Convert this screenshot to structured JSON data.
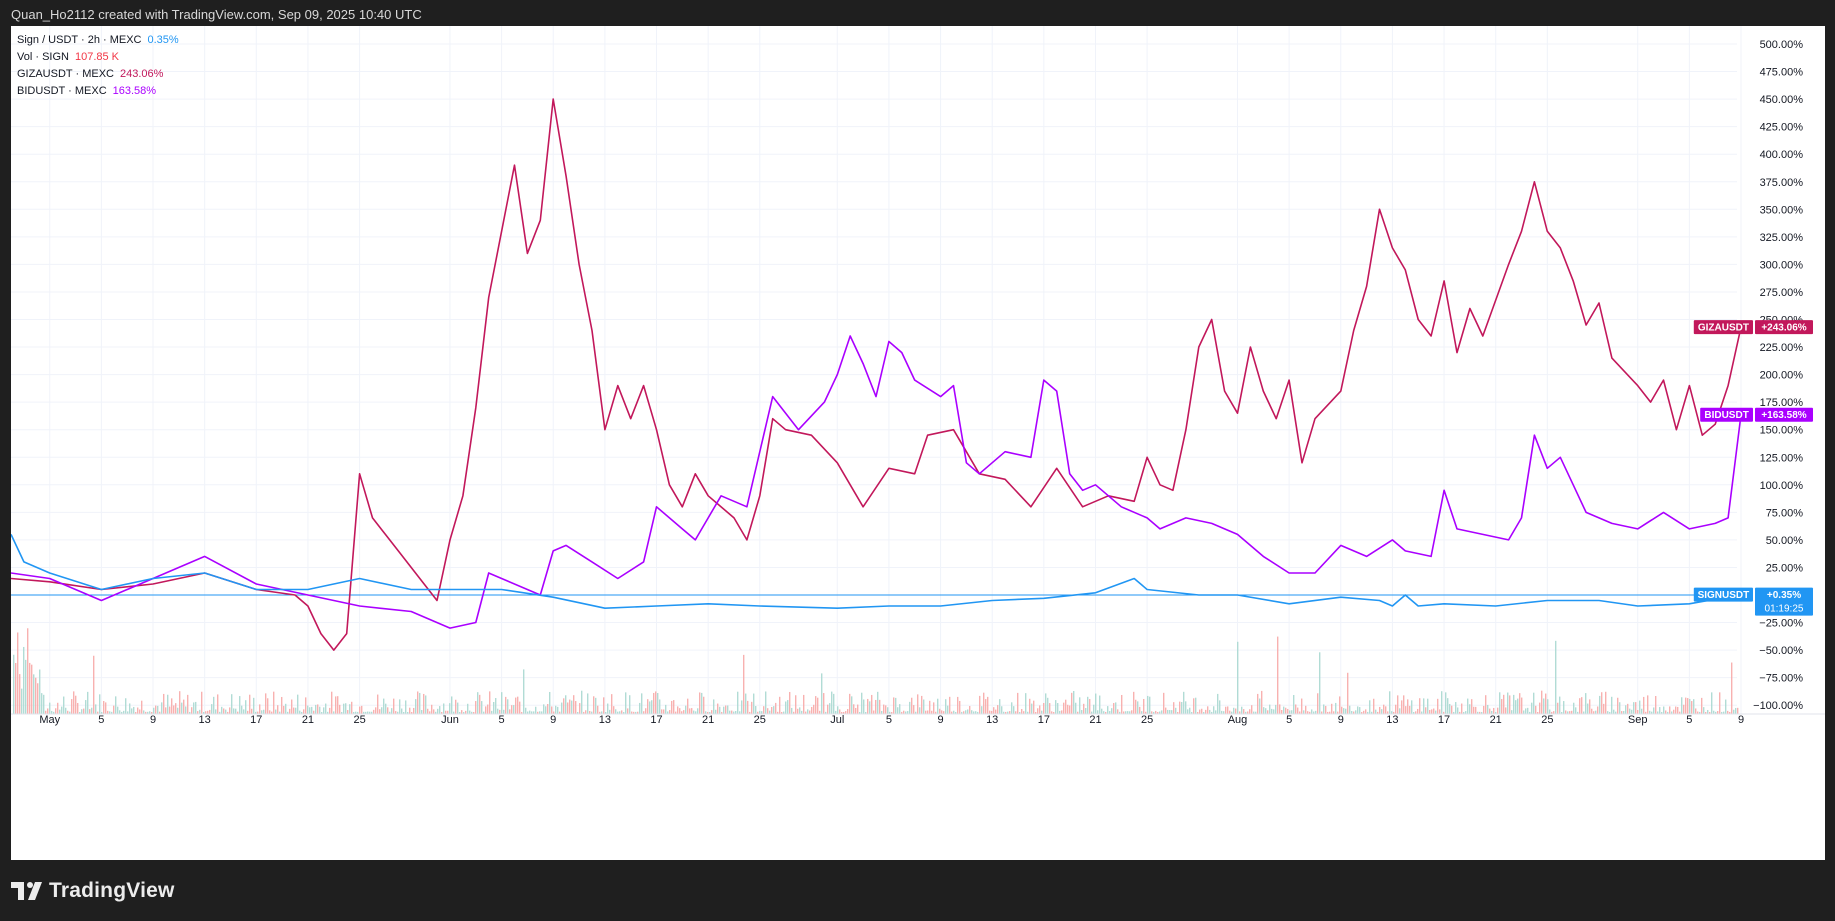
{
  "header": {
    "text": "Quan_Ho2112 created with TradingView.com, Sep 09, 2025 10:40 UTC"
  },
  "legend": [
    {
      "label": "Sign / USDT · 2h · MEXC",
      "value": "0.35%",
      "color": "#2196f3"
    },
    {
      "label": "Vol · SIGN",
      "value": "107.85 K",
      "color": "#f23645"
    },
    {
      "label": "GIZAUSDT · MEXC",
      "value": "243.06%",
      "color": "#c2185b"
    },
    {
      "label": "BIDUSDT · MEXC",
      "value": "163.58%",
      "color": "#aa00ff"
    }
  ],
  "footer": {
    "logo_text": "TradingView",
    "logo_icon": "tradingview-logo-icon"
  },
  "chart_data": {
    "type": "line",
    "y_unit": "%",
    "ylim": [
      -100,
      500
    ],
    "y_ticks": [
      -100,
      -75,
      -50,
      -25,
      0,
      25,
      50,
      75,
      100,
      125,
      150,
      175,
      200,
      225,
      250,
      275,
      300,
      325,
      350,
      375,
      400,
      425,
      450,
      475,
      500
    ],
    "y_tick_labels": [
      "−100.00%",
      "−75.00%",
      "−50.00%",
      "−25.00%",
      "0.00%",
      "25.00%",
      "50.00%",
      "75.00%",
      "100.00%",
      "125.00%",
      "150.00%",
      "175.00%",
      "200.00%",
      "225.00%",
      "250.00%",
      "275.00%",
      "300.00%",
      "325.00%",
      "350.00%",
      "375.00%",
      "400.00%",
      "425.00%",
      "450.00%",
      "475.00%",
      "500.00%"
    ],
    "x_range": [
      "2025-04-28",
      "2025-09-09"
    ],
    "x_ticks": [
      {
        "label": "May",
        "date": "2025-05-01"
      },
      {
        "label": "5",
        "date": "2025-05-05"
      },
      {
        "label": "9",
        "date": "2025-05-09"
      },
      {
        "label": "13",
        "date": "2025-05-13"
      },
      {
        "label": "17",
        "date": "2025-05-17"
      },
      {
        "label": "21",
        "date": "2025-05-21"
      },
      {
        "label": "25",
        "date": "2025-05-25"
      },
      {
        "label": "Jun",
        "date": "2025-06-01"
      },
      {
        "label": "5",
        "date": "2025-06-05"
      },
      {
        "label": "9",
        "date": "2025-06-09"
      },
      {
        "label": "13",
        "date": "2025-06-13"
      },
      {
        "label": "17",
        "date": "2025-06-17"
      },
      {
        "label": "21",
        "date": "2025-06-21"
      },
      {
        "label": "25",
        "date": "2025-06-25"
      },
      {
        "label": "Jul",
        "date": "2025-07-01"
      },
      {
        "label": "5",
        "date": "2025-07-05"
      },
      {
        "label": "9",
        "date": "2025-07-09"
      },
      {
        "label": "13",
        "date": "2025-07-13"
      },
      {
        "label": "17",
        "date": "2025-07-17"
      },
      {
        "label": "21",
        "date": "2025-07-21"
      },
      {
        "label": "25",
        "date": "2025-07-25"
      },
      {
        "label": "Aug",
        "date": "2025-08-01"
      },
      {
        "label": "5",
        "date": "2025-08-05"
      },
      {
        "label": "9",
        "date": "2025-08-09"
      },
      {
        "label": "13",
        "date": "2025-08-13"
      },
      {
        "label": "17",
        "date": "2025-08-17"
      },
      {
        "label": "21",
        "date": "2025-08-21"
      },
      {
        "label": "25",
        "date": "2025-08-25"
      },
      {
        "label": "Sep",
        "date": "2025-09-01"
      },
      {
        "label": "5",
        "date": "2025-09-05"
      },
      {
        "label": "9",
        "date": "2025-09-09"
      }
    ],
    "grid": true,
    "series": [
      {
        "name": "GIZAUSDT",
        "color": "#c2185b",
        "last_label": "GIZAUSDT",
        "last_value_label": "+243.06%",
        "points": [
          [
            "2025-04-28",
            15
          ],
          [
            "2025-05-01",
            12
          ],
          [
            "2025-05-05",
            5
          ],
          [
            "2025-05-09",
            10
          ],
          [
            "2025-05-13",
            20
          ],
          [
            "2025-05-17",
            5
          ],
          [
            "2025-05-20",
            0
          ],
          [
            "2025-05-21",
            -10
          ],
          [
            "2025-05-22",
            -35
          ],
          [
            "2025-05-23",
            -50
          ],
          [
            "2025-05-24",
            -35
          ],
          [
            "2025-05-25",
            110
          ],
          [
            "2025-05-26",
            70
          ],
          [
            "2025-05-27",
            55
          ],
          [
            "2025-05-28",
            40
          ],
          [
            "2025-05-30",
            10
          ],
          [
            "2025-05-31",
            -5
          ],
          [
            "2025-06-01",
            50
          ],
          [
            "2025-06-02",
            90
          ],
          [
            "2025-06-03",
            170
          ],
          [
            "2025-06-04",
            270
          ],
          [
            "2025-06-05",
            330
          ],
          [
            "2025-06-06",
            390
          ],
          [
            "2025-06-07",
            310
          ],
          [
            "2025-06-08",
            340
          ],
          [
            "2025-06-09",
            450
          ],
          [
            "2025-06-10",
            380
          ],
          [
            "2025-06-11",
            300
          ],
          [
            "2025-06-12",
            240
          ],
          [
            "2025-06-13",
            150
          ],
          [
            "2025-06-14",
            190
          ],
          [
            "2025-06-15",
            160
          ],
          [
            "2025-06-16",
            190
          ],
          [
            "2025-06-17",
            150
          ],
          [
            "2025-06-18",
            100
          ],
          [
            "2025-06-19",
            80
          ],
          [
            "2025-06-20",
            110
          ],
          [
            "2025-06-21",
            90
          ],
          [
            "2025-06-23",
            70
          ],
          [
            "2025-06-24",
            50
          ],
          [
            "2025-06-25",
            90
          ],
          [
            "2025-06-26",
            160
          ],
          [
            "2025-06-27",
            150
          ],
          [
            "2025-06-29",
            145
          ],
          [
            "2025-07-01",
            120
          ],
          [
            "2025-07-03",
            80
          ],
          [
            "2025-07-05",
            115
          ],
          [
            "2025-07-07",
            110
          ],
          [
            "2025-07-08",
            145
          ],
          [
            "2025-07-10",
            150
          ],
          [
            "2025-07-12",
            110
          ],
          [
            "2025-07-14",
            105
          ],
          [
            "2025-07-16",
            80
          ],
          [
            "2025-07-18",
            115
          ],
          [
            "2025-07-20",
            80
          ],
          [
            "2025-07-22",
            90
          ],
          [
            "2025-07-24",
            85
          ],
          [
            "2025-07-25",
            125
          ],
          [
            "2025-07-26",
            100
          ],
          [
            "2025-07-27",
            95
          ],
          [
            "2025-07-28",
            150
          ],
          [
            "2025-07-29",
            225
          ],
          [
            "2025-07-30",
            250
          ],
          [
            "2025-07-31",
            185
          ],
          [
            "2025-08-01",
            165
          ],
          [
            "2025-08-02",
            225
          ],
          [
            "2025-08-03",
            185
          ],
          [
            "2025-08-04",
            160
          ],
          [
            "2025-08-05",
            195
          ],
          [
            "2025-08-06",
            120
          ],
          [
            "2025-08-07",
            160
          ],
          [
            "2025-08-09",
            185
          ],
          [
            "2025-08-10",
            240
          ],
          [
            "2025-08-11",
            280
          ],
          [
            "2025-08-12",
            350
          ],
          [
            "2025-08-13",
            315
          ],
          [
            "2025-08-14",
            295
          ],
          [
            "2025-08-15",
            250
          ],
          [
            "2025-08-16",
            235
          ],
          [
            "2025-08-17",
            285
          ],
          [
            "2025-08-18",
            220
          ],
          [
            "2025-08-19",
            260
          ],
          [
            "2025-08-20",
            235
          ],
          [
            "2025-08-22",
            300
          ],
          [
            "2025-08-23",
            330
          ],
          [
            "2025-08-24",
            375
          ],
          [
            "2025-08-25",
            330
          ],
          [
            "2025-08-26",
            315
          ],
          [
            "2025-08-27",
            285
          ],
          [
            "2025-08-28",
            245
          ],
          [
            "2025-08-29",
            265
          ],
          [
            "2025-08-30",
            215
          ],
          [
            "2025-09-01",
            190
          ],
          [
            "2025-09-02",
            175
          ],
          [
            "2025-09-03",
            195
          ],
          [
            "2025-09-04",
            150
          ],
          [
            "2025-09-05",
            190
          ],
          [
            "2025-09-06",
            145
          ],
          [
            "2025-09-07",
            155
          ],
          [
            "2025-09-08",
            190
          ],
          [
            "2025-09-09",
            243.06
          ]
        ]
      },
      {
        "name": "BIDUSDT",
        "color": "#aa00ff",
        "last_label": "BIDUSDT",
        "last_value_label": "+163.58%",
        "points": [
          [
            "2025-04-28",
            20
          ],
          [
            "2025-05-01",
            15
          ],
          [
            "2025-05-05",
            -5
          ],
          [
            "2025-05-09",
            15
          ],
          [
            "2025-05-13",
            35
          ],
          [
            "2025-05-17",
            10
          ],
          [
            "2025-05-21",
            0
          ],
          [
            "2025-05-25",
            -10
          ],
          [
            "2025-05-29",
            -15
          ],
          [
            "2025-06-01",
            -30
          ],
          [
            "2025-06-03",
            -25
          ],
          [
            "2025-06-04",
            20
          ],
          [
            "2025-06-05",
            15
          ],
          [
            "2025-06-08",
            0
          ],
          [
            "2025-06-09",
            40
          ],
          [
            "2025-06-10",
            45
          ],
          [
            "2025-06-12",
            30
          ],
          [
            "2025-06-14",
            15
          ],
          [
            "2025-06-16",
            30
          ],
          [
            "2025-06-17",
            80
          ],
          [
            "2025-06-19",
            60
          ],
          [
            "2025-06-20",
            50
          ],
          [
            "2025-06-22",
            90
          ],
          [
            "2025-06-24",
            80
          ],
          [
            "2025-06-26",
            180
          ],
          [
            "2025-06-28",
            150
          ],
          [
            "2025-06-30",
            175
          ],
          [
            "2025-07-01",
            200
          ],
          [
            "2025-07-02",
            235
          ],
          [
            "2025-07-03",
            210
          ],
          [
            "2025-07-04",
            180
          ],
          [
            "2025-07-05",
            230
          ],
          [
            "2025-07-06",
            220
          ],
          [
            "2025-07-07",
            195
          ],
          [
            "2025-07-09",
            180
          ],
          [
            "2025-07-10",
            190
          ],
          [
            "2025-07-11",
            120
          ],
          [
            "2025-07-12",
            110
          ],
          [
            "2025-07-14",
            130
          ],
          [
            "2025-07-16",
            125
          ],
          [
            "2025-07-17",
            195
          ],
          [
            "2025-07-18",
            185
          ],
          [
            "2025-07-19",
            110
          ],
          [
            "2025-07-20",
            95
          ],
          [
            "2025-07-21",
            100
          ],
          [
            "2025-07-23",
            80
          ],
          [
            "2025-07-25",
            70
          ],
          [
            "2025-07-26",
            60
          ],
          [
            "2025-07-28",
            70
          ],
          [
            "2025-07-30",
            65
          ],
          [
            "2025-08-01",
            55
          ],
          [
            "2025-08-03",
            35
          ],
          [
            "2025-08-05",
            20
          ],
          [
            "2025-08-07",
            20
          ],
          [
            "2025-08-09",
            45
          ],
          [
            "2025-08-11",
            35
          ],
          [
            "2025-08-13",
            50
          ],
          [
            "2025-08-14",
            40
          ],
          [
            "2025-08-16",
            35
          ],
          [
            "2025-08-17",
            95
          ],
          [
            "2025-08-18",
            60
          ],
          [
            "2025-08-20",
            55
          ],
          [
            "2025-08-22",
            50
          ],
          [
            "2025-08-23",
            70
          ],
          [
            "2025-08-24",
            145
          ],
          [
            "2025-08-25",
            115
          ],
          [
            "2025-08-26",
            125
          ],
          [
            "2025-08-27",
            100
          ],
          [
            "2025-08-28",
            75
          ],
          [
            "2025-08-30",
            65
          ],
          [
            "2025-09-01",
            60
          ],
          [
            "2025-09-03",
            75
          ],
          [
            "2025-09-05",
            60
          ],
          [
            "2025-09-07",
            65
          ],
          [
            "2025-09-08",
            70
          ],
          [
            "2025-09-09",
            163.58
          ]
        ]
      },
      {
        "name": "SIGNUSDT",
        "color": "#2196f3",
        "last_label": "SIGNUSDT",
        "last_value_label": "+0.35%",
        "countdown_label": "01:19:25",
        "points": [
          [
            "2025-04-28",
            55
          ],
          [
            "2025-04-29",
            30
          ],
          [
            "2025-05-01",
            20
          ],
          [
            "2025-05-05",
            5
          ],
          [
            "2025-05-09",
            15
          ],
          [
            "2025-05-13",
            20
          ],
          [
            "2025-05-17",
            5
          ],
          [
            "2025-05-21",
            5
          ],
          [
            "2025-05-25",
            15
          ],
          [
            "2025-05-29",
            5
          ],
          [
            "2025-06-01",
            5
          ],
          [
            "2025-06-05",
            5
          ],
          [
            "2025-06-09",
            -2
          ],
          [
            "2025-06-13",
            -12
          ],
          [
            "2025-06-17",
            -10
          ],
          [
            "2025-06-21",
            -8
          ],
          [
            "2025-06-25",
            -10
          ],
          [
            "2025-07-01",
            -12
          ],
          [
            "2025-07-05",
            -10
          ],
          [
            "2025-07-09",
            -10
          ],
          [
            "2025-07-13",
            -5
          ],
          [
            "2025-07-17",
            -3
          ],
          [
            "2025-07-21",
            2
          ],
          [
            "2025-07-24",
            15
          ],
          [
            "2025-07-25",
            5
          ],
          [
            "2025-07-29",
            0
          ],
          [
            "2025-08-01",
            0
          ],
          [
            "2025-08-05",
            -8
          ],
          [
            "2025-08-09",
            -2
          ],
          [
            "2025-08-12",
            -5
          ],
          [
            "2025-08-13",
            -10
          ],
          [
            "2025-08-14",
            0
          ],
          [
            "2025-08-15",
            -10
          ],
          [
            "2025-08-17",
            -8
          ],
          [
            "2025-08-21",
            -10
          ],
          [
            "2025-08-25",
            -5
          ],
          [
            "2025-08-29",
            -5
          ],
          [
            "2025-09-01",
            -10
          ],
          [
            "2025-09-05",
            -8
          ],
          [
            "2025-09-09",
            0.35
          ]
        ]
      }
    ]
  }
}
